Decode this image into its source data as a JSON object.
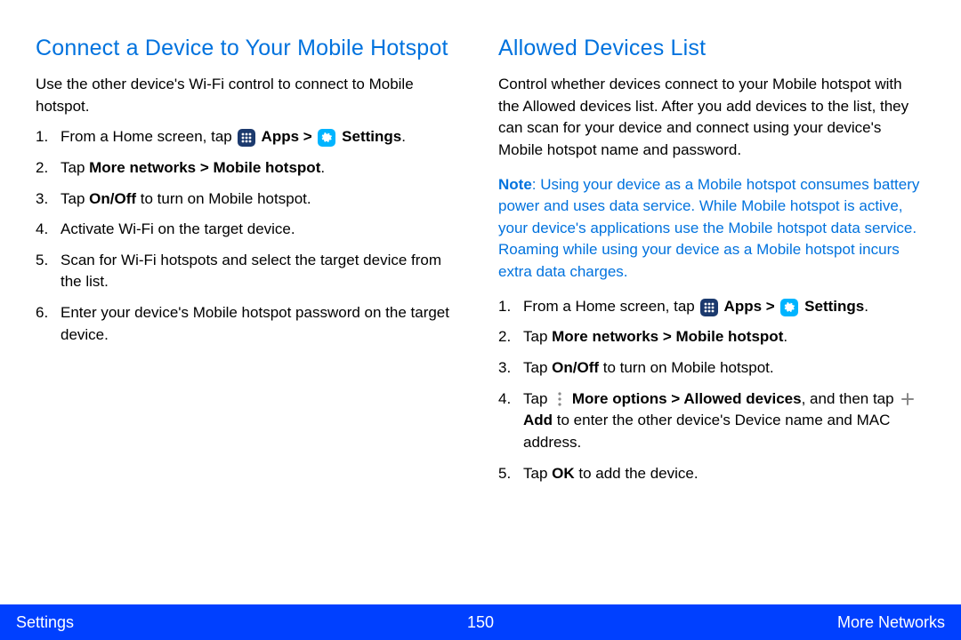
{
  "left": {
    "heading": "Connect a Device to Your Mobile Hotspot",
    "intro": "Use the other device's Wi-Fi control to connect to Mobile hotspot.",
    "steps": {
      "s1_a": "From a Home screen, tap ",
      "s1_apps": " Apps > ",
      "s1_settings": " Settings",
      "s1_end": ".",
      "s2_a": "Tap ",
      "s2_b": "More networks > Mobile hotspot",
      "s2_end": ".",
      "s3_a": "Tap ",
      "s3_b": "On/Off",
      "s3_c": " to turn on Mobile hotspot.",
      "s4": "Activate Wi-Fi on the target device.",
      "s5": "Scan for Wi-Fi hotspots and select the target device from the list.",
      "s6": "Enter your device's Mobile hotspot password on the target device."
    }
  },
  "right": {
    "heading": "Allowed Devices List",
    "intro": "Control whether devices connect to your Mobile hotspot with the Allowed devices list. After you add devices to the list, they can scan for your device and connect using your device's Mobile hotspot name and password.",
    "note_label": "Note",
    "note_body": ": Using your device as a Mobile hotspot consumes battery power and uses data service. While Mobile hotspot is active, your device's applications use the Mobile hotspot data service. Roaming while using your device as a Mobile hotspot incurs extra data charges.",
    "steps": {
      "s1_a": "From a Home screen, tap ",
      "s1_apps": " Apps > ",
      "s1_settings": " Settings",
      "s1_end": ".",
      "s2_a": "Tap ",
      "s2_b": "More networks > Mobile hotspot",
      "s2_end": ".",
      "s3_a": "Tap ",
      "s3_b": "On/Off",
      "s3_c": " to turn on Mobile hotspot.",
      "s4_a": "Tap ",
      "s4_b": " More options > Allowed devices",
      "s4_c": ", and then tap ",
      "s4_d": " Add",
      "s4_e": " to enter the other device's Device name and MAC address.",
      "s5_a": "Tap ",
      "s5_b": "OK",
      "s5_c": " to add the device."
    }
  },
  "footer": {
    "left": "Settings",
    "center": "150",
    "right": "More Networks"
  }
}
